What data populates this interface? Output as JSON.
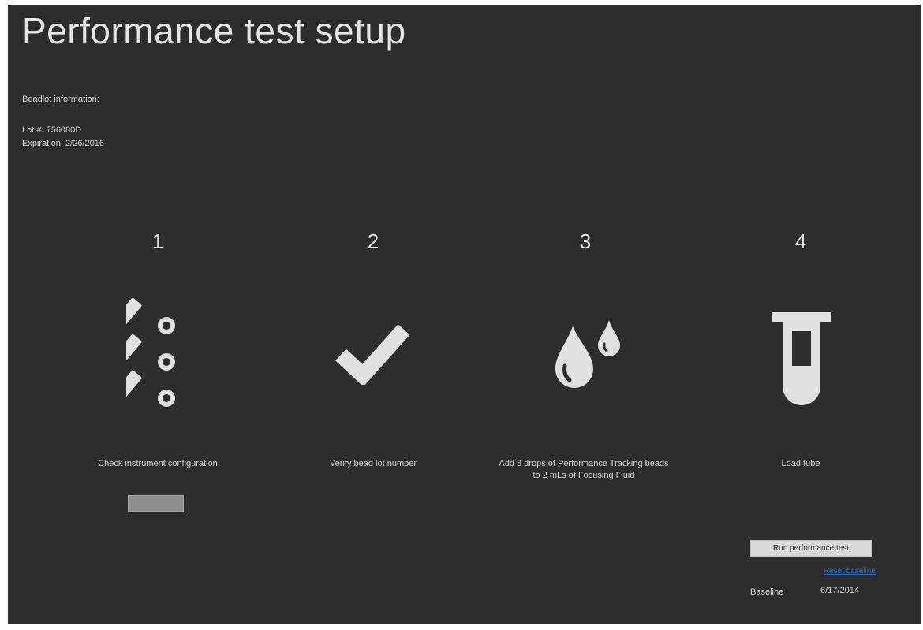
{
  "page": {
    "title": "Performance test setup",
    "background": "#2d2d2d",
    "accent": "#1e6fd6"
  },
  "beadlot": {
    "heading": "Beadlot information:",
    "lot": "Lot #: 756080D",
    "expiration": "Expiration: 2/26/2016"
  },
  "steps": [
    {
      "number": "1",
      "label": "Check instrument configuration",
      "icon": "tubes-icon"
    },
    {
      "number": "2",
      "label": "Verify bead lot number",
      "icon": "checkmark-icon"
    },
    {
      "number": "3",
      "label": "Add 3 drops of Performance Tracking beads to 2 mLs of Focusing Fluid",
      "icon": "drops-icon"
    },
    {
      "number": "4",
      "label": "Load tube",
      "icon": "test-tube-icon"
    }
  ],
  "actions": {
    "run_label": "Run performance test",
    "reset_label": "Reset baseline"
  },
  "baseline": {
    "label": "Baseline",
    "date": "6/17/2014"
  }
}
